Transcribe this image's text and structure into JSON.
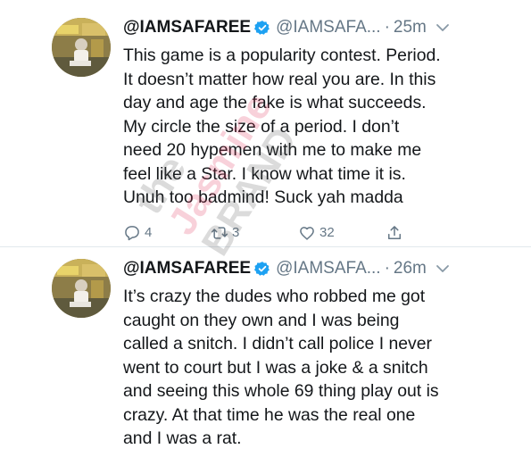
{
  "tweets": [
    {
      "handle": "@IAMSAFAREE",
      "screen_name": "@IAMSAFA...",
      "separator": "·",
      "time": "25m",
      "lines": [
        "This game is a popularity contest. Period.",
        "It doesn’t matter how real you are. In this",
        "day and age the fake is what succeeds.",
        "My circle the size of a period. I don’t",
        "need 20 hypemen with me to make me",
        "feel like a Star. I know what time it is.",
        "Unuh too badmind! Suck yah madda"
      ],
      "replies": "4",
      "retweets": "3",
      "likes": "32"
    },
    {
      "handle": "@IAMSAFAREE",
      "screen_name": "@IAMSAFA...",
      "separator": "·",
      "time": "26m",
      "lines": [
        "It’s crazy the dudes who robbed me got",
        "caught on they own and I was being",
        "called a snitch. I didn’t call police I never",
        "went to court but I was a joke & a snitch",
        "and seeing this whole 69 thing play out is",
        "crazy. At that time he was the real one",
        "and I was a rat."
      ]
    }
  ],
  "watermark": {
    "line1": "the",
    "line2": "Jasmine",
    "line3": "BRAND"
  },
  "colors": {
    "verified": "#1da1f2",
    "muted": "#657786",
    "text": "#14171a"
  }
}
